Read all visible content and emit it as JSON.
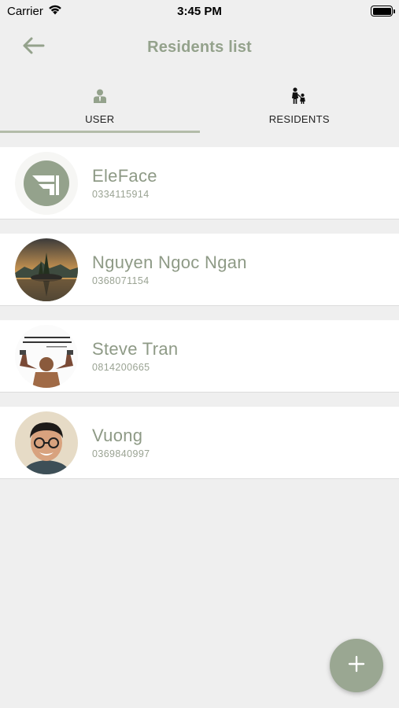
{
  "status_bar": {
    "carrier": "Carrier",
    "time": "3:45 PM"
  },
  "header": {
    "title": "Residents list"
  },
  "tabs": [
    {
      "label": "USER",
      "icon": "user-icon",
      "selected": true
    },
    {
      "label": "RESIDENTS",
      "icon": "family-icon",
      "selected": false
    }
  ],
  "residents": [
    {
      "name": "EleFace",
      "phone": "0334115914",
      "avatar": "eleface-logo"
    },
    {
      "name": "Nguyen Ngoc Ngan",
      "phone": "0368071154",
      "avatar": "landscape-photo"
    },
    {
      "name": "Steve Tran",
      "phone": "0814200665",
      "avatar": "quote-photo"
    },
    {
      "name": "Vuong",
      "phone": "0369840997",
      "avatar": "portrait-photo"
    }
  ],
  "colors": {
    "accent": "#94a28c",
    "fab": "#9aa792",
    "background": "#efefef"
  }
}
